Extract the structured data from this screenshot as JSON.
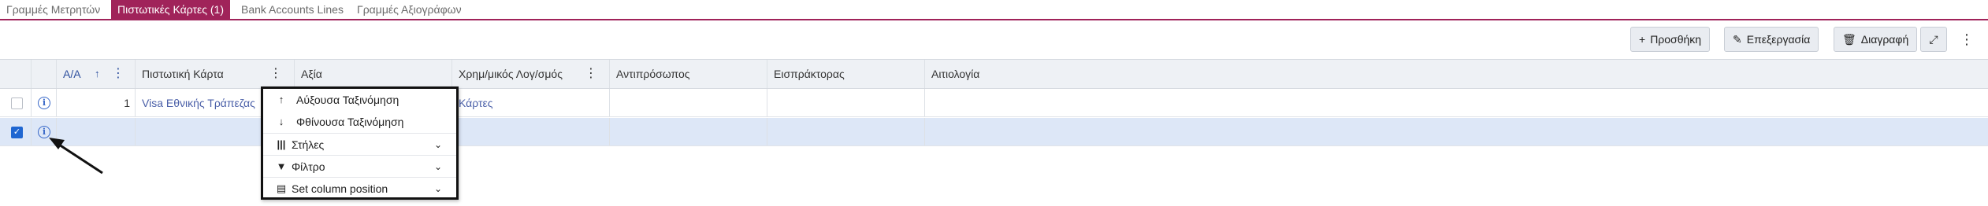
{
  "tabs": [
    {
      "label": "Γραμμές Μετρητών",
      "active": false
    },
    {
      "label": "Πιστωτικές Κάρτες (1)",
      "active": true
    },
    {
      "label": "Bank Accounts Lines",
      "active": false
    },
    {
      "label": "Γραμμές Αξιογράφων",
      "active": false
    }
  ],
  "toolbar": {
    "add_label": "Προσθήκη",
    "edit_label": "Επεξεργασία",
    "delete_label": "Διαγραφή"
  },
  "columns": {
    "aa": "Α/Α",
    "card": "Πιστωτική Κάρτα",
    "value": "Αξία",
    "account": "Χρημ/μικός Λογ/σμός",
    "representative": "Αντιπρόσωπος",
    "collector": "Εισπράκτορας",
    "reason": "Αιτιολογία"
  },
  "rows": [
    {
      "aa": "1",
      "card": "Visa Εθνικής Τράπεζας",
      "account_partial": "Κάρτες",
      "selected": false
    },
    {
      "aa": "",
      "card": "",
      "account_partial": "",
      "selected": true
    }
  ],
  "column_menu": {
    "sort_asc": "Αύξουσα Ταξινόμηση",
    "sort_desc": "Φθίνουσα Ταξινόμηση",
    "columns": "Στήλες",
    "filter": "Φίλτρο",
    "set_position": "Set column position"
  },
  "colors": {
    "accent": "#a0235a",
    "link": "#4a5fa8",
    "selected_row": "#dde7f7"
  }
}
